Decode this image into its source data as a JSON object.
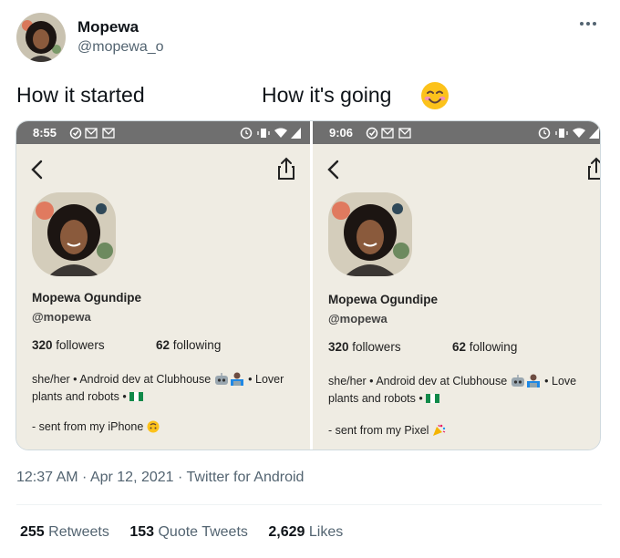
{
  "tweet": {
    "author_name": "Mopewa",
    "author_handle": "@mopewa_o",
    "text_left": "How it started",
    "text_right": "How it's going",
    "timestamp": "12:37 AM · Apr 12, 2021 · Twitter for Android",
    "retweets_count": "255",
    "retweets_label": "Retweets",
    "quotes_count": "153",
    "quotes_label": "Quote Tweets",
    "likes_count": "2,629",
    "likes_label": "Likes"
  },
  "screenshots": [
    {
      "status_time": "8:55",
      "profile_name": "Mopewa Ogundipe",
      "profile_handle": "@mopewa",
      "followers_count": "320",
      "followers_label": "followers",
      "following_count": "62",
      "following_label": "following",
      "bio_line1": "she/her • Android dev at Clubhouse",
      "bio_line1_tail": "• Lover",
      "bio_line2": "plants and robots •",
      "sent_from": "- sent from my iPhone"
    },
    {
      "status_time": "9:06",
      "profile_name": "Mopewa Ogundipe",
      "profile_handle": "@mopewa",
      "followers_count": "320",
      "followers_label": "followers",
      "following_count": "62",
      "following_label": "following",
      "bio_line1": "she/her • Android dev at Clubhouse",
      "bio_line1_tail": "• Love",
      "bio_line2": "plants and robots •",
      "sent_from": "- sent from my Pixel"
    }
  ],
  "colors": {
    "accent": "#1d9bf0",
    "secondary_text": "#536471",
    "app_background": "#efece3",
    "status_bar": "#6f6f6f"
  },
  "icons": [
    "more-icon",
    "smiling-face-emoji",
    "check-circle-icon",
    "gmail-icon",
    "alarm-icon",
    "vibrate-icon",
    "wifi-icon",
    "signal-icon",
    "back-arrow-icon",
    "share-icon",
    "robot-emoji",
    "technologist-emoji",
    "nigeria-flag-emoji",
    "upside-down-face-emoji",
    "party-popper-emoji"
  ]
}
